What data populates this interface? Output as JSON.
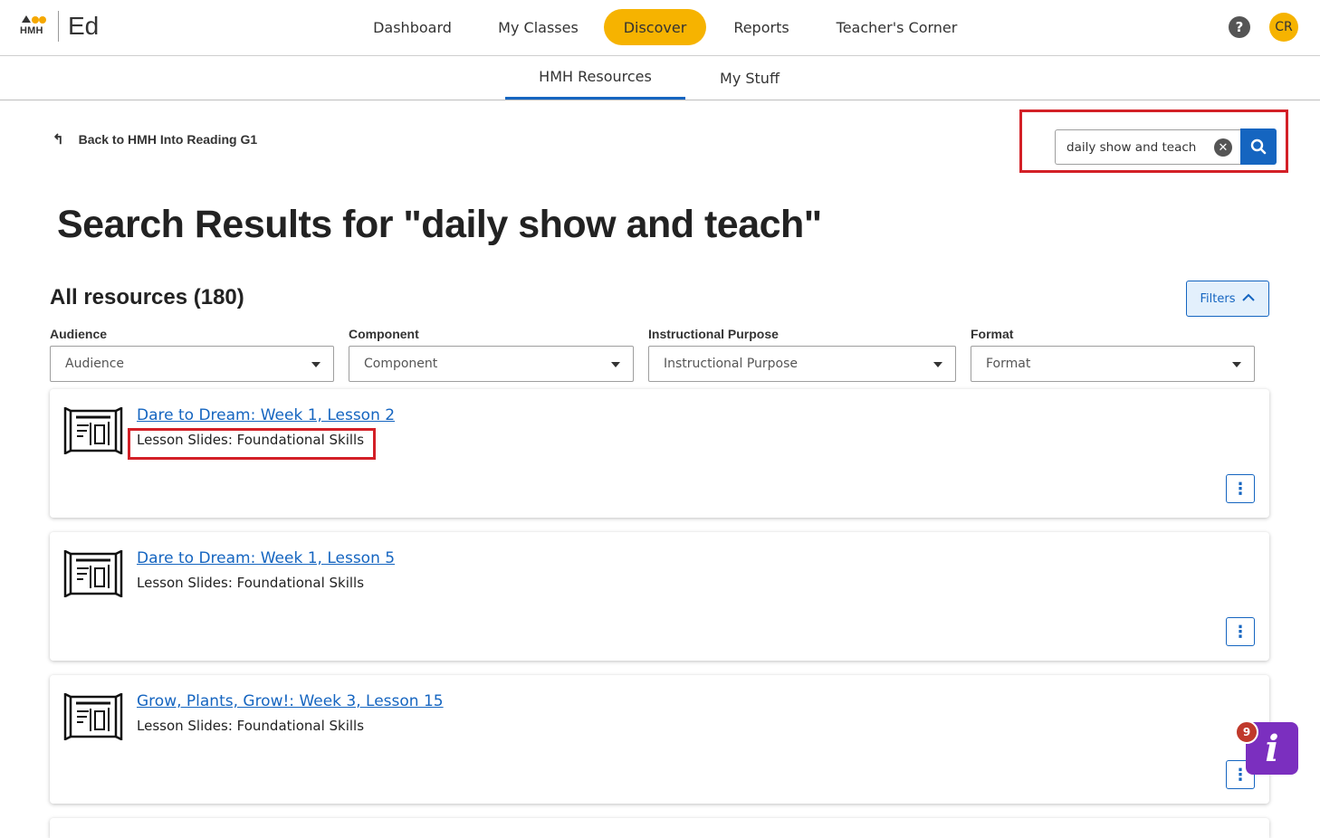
{
  "app": {
    "logo_text": "HMH",
    "product": "Ed"
  },
  "nav": {
    "items": [
      {
        "label": "Dashboard"
      },
      {
        "label": "My Classes"
      },
      {
        "label": "Discover"
      },
      {
        "label": "Reports"
      },
      {
        "label": "Teacher's Corner"
      }
    ],
    "active_index": 2
  },
  "header": {
    "help_icon": "question-icon",
    "help_glyph": "?",
    "avatar_initials": "CR"
  },
  "subnav": {
    "tabs": [
      {
        "label": "HMH Resources"
      },
      {
        "label": "My Stuff"
      }
    ],
    "active_index": 0
  },
  "back_link": {
    "label": "Back to HMH Into Reading G1",
    "icon": "return-arrow-icon"
  },
  "search": {
    "value": "daily show and teach",
    "clear_icon": "clear-icon",
    "button_icon": "search-icon"
  },
  "results": {
    "heading": "Search Results for \"daily show and teach\"",
    "count_label": "All resources (180)"
  },
  "filters": {
    "toggle_label": "Filters",
    "dropdowns": [
      {
        "label": "Audience",
        "value": "Audience"
      },
      {
        "label": "Component",
        "value": "Component"
      },
      {
        "label": "Instructional Purpose",
        "value": "Instructional Purpose"
      },
      {
        "label": "Format",
        "value": "Format"
      }
    ]
  },
  "cards": [
    {
      "title": "Dare to Dream: Week 1, Lesson 2",
      "subtitle": "Lesson Slides: Foundational Skills",
      "icon": "lesson-slides-icon"
    },
    {
      "title": "Dare to Dream: Week 1, Lesson 5",
      "subtitle": "Lesson Slides: Foundational Skills",
      "icon": "lesson-slides-icon"
    },
    {
      "title": "Grow, Plants, Grow!: Week 3, Lesson 15",
      "subtitle": "Lesson Slides: Foundational Skills",
      "icon": "lesson-slides-icon"
    }
  ],
  "card_menu_glyph": "⋮",
  "info_widget": {
    "badge_count": "9",
    "glyph": "i",
    "icon": "info-icon"
  },
  "colors": {
    "accent": "#1565c0",
    "nav_active": "#f6b300",
    "highlight": "#d32027",
    "info_widget": "#7b2fbf"
  }
}
